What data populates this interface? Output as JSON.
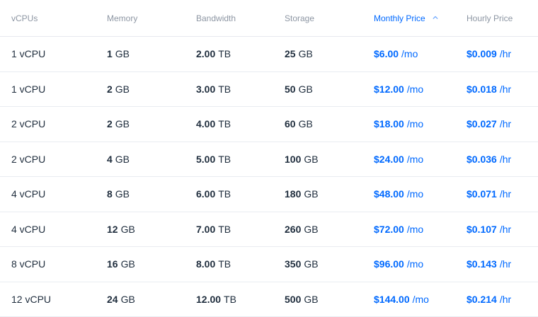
{
  "headers": {
    "vcpus": "vCPUs",
    "memory": "Memory",
    "bandwidth": "Bandwidth",
    "storage": "Storage",
    "monthly": "Monthly Price",
    "hourly": "Hourly Price"
  },
  "sort": {
    "active_column": "Monthly Price",
    "icon": "sort-icon",
    "accent_color": "#0069ff"
  },
  "rows": [
    {
      "vcpus": "1 vCPU",
      "memory": {
        "num": "1",
        "unit": "GB"
      },
      "bandwidth": {
        "num": "2.00",
        "unit": "TB"
      },
      "storage": {
        "num": "25",
        "unit": "GB"
      },
      "monthly": {
        "num": "$6.00",
        "unit": "/mo"
      },
      "hourly": {
        "num": "$0.009",
        "unit": "/hr"
      }
    },
    {
      "vcpus": "1 vCPU",
      "memory": {
        "num": "2",
        "unit": "GB"
      },
      "bandwidth": {
        "num": "3.00",
        "unit": "TB"
      },
      "storage": {
        "num": "50",
        "unit": "GB"
      },
      "monthly": {
        "num": "$12.00",
        "unit": "/mo"
      },
      "hourly": {
        "num": "$0.018",
        "unit": "/hr"
      }
    },
    {
      "vcpus": "2 vCPU",
      "memory": {
        "num": "2",
        "unit": "GB"
      },
      "bandwidth": {
        "num": "4.00",
        "unit": "TB"
      },
      "storage": {
        "num": "60",
        "unit": "GB"
      },
      "monthly": {
        "num": "$18.00",
        "unit": "/mo"
      },
      "hourly": {
        "num": "$0.027",
        "unit": "/hr"
      }
    },
    {
      "vcpus": "2 vCPU",
      "memory": {
        "num": "4",
        "unit": "GB"
      },
      "bandwidth": {
        "num": "5.00",
        "unit": "TB"
      },
      "storage": {
        "num": "100",
        "unit": "GB"
      },
      "monthly": {
        "num": "$24.00",
        "unit": "/mo"
      },
      "hourly": {
        "num": "$0.036",
        "unit": "/hr"
      }
    },
    {
      "vcpus": "4 vCPU",
      "memory": {
        "num": "8",
        "unit": "GB"
      },
      "bandwidth": {
        "num": "6.00",
        "unit": "TB"
      },
      "storage": {
        "num": "180",
        "unit": "GB"
      },
      "monthly": {
        "num": "$48.00",
        "unit": "/mo"
      },
      "hourly": {
        "num": "$0.071",
        "unit": "/hr"
      }
    },
    {
      "vcpus": "4 vCPU",
      "memory": {
        "num": "12",
        "unit": "GB"
      },
      "bandwidth": {
        "num": "7.00",
        "unit": "TB"
      },
      "storage": {
        "num": "260",
        "unit": "GB"
      },
      "monthly": {
        "num": "$72.00",
        "unit": "/mo"
      },
      "hourly": {
        "num": "$0.107",
        "unit": "/hr"
      }
    },
    {
      "vcpus": "8 vCPU",
      "memory": {
        "num": "16",
        "unit": "GB"
      },
      "bandwidth": {
        "num": "8.00",
        "unit": "TB"
      },
      "storage": {
        "num": "350",
        "unit": "GB"
      },
      "monthly": {
        "num": "$96.00",
        "unit": "/mo"
      },
      "hourly": {
        "num": "$0.143",
        "unit": "/hr"
      }
    },
    {
      "vcpus": "12 vCPU",
      "memory": {
        "num": "24",
        "unit": "GB"
      },
      "bandwidth": {
        "num": "12.00",
        "unit": "TB"
      },
      "storage": {
        "num": "500",
        "unit": "GB"
      },
      "monthly": {
        "num": "$144.00",
        "unit": "/mo"
      },
      "hourly": {
        "num": "$0.214",
        "unit": "/hr"
      }
    }
  ]
}
